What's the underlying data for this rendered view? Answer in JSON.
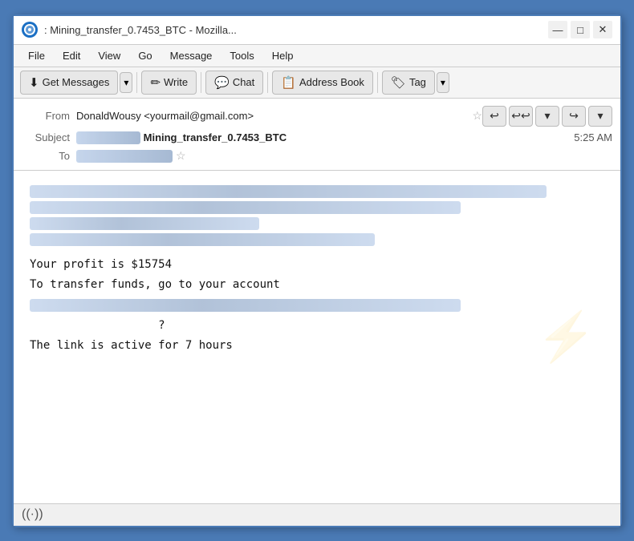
{
  "window": {
    "title": ": Mining_transfer_0.7453_BTC - Mozilla...",
    "icon_label": "T"
  },
  "titlebar": {
    "minimize": "—",
    "maximize": "□",
    "close": "✕"
  },
  "menubar": {
    "items": [
      "File",
      "Edit",
      "View",
      "Go",
      "Message",
      "Tools",
      "Help"
    ]
  },
  "toolbar": {
    "get_messages": "Get Messages",
    "write": "Write",
    "chat": "Chat",
    "address_book": "Address Book",
    "tag": "Tag"
  },
  "email": {
    "from_label": "From",
    "from_value": "DonaldWousy <yourmail@gmail.com>",
    "subject_label": "Subject",
    "subject_prefix": ":",
    "subject_main": "Mining_transfer_0.7453_BTC",
    "time": "5:25 AM",
    "to_label": "To",
    "body_line1": "Your profit is $15754",
    "body_line2": "To transfer funds, go to your  account",
    "body_question": "?",
    "body_line3": "The link is active for 7 hours"
  },
  "statusbar": {
    "radio_symbol": "((·))"
  }
}
